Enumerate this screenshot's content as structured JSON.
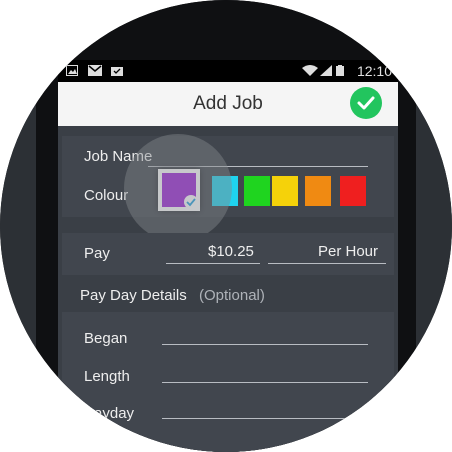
{
  "status_bar": {
    "time": "12:10",
    "icons": [
      "image-icon",
      "gmail-icon",
      "shopping-bag-icon",
      "wifi-icon",
      "signal-icon",
      "battery-icon"
    ]
  },
  "header": {
    "title": "Add Job",
    "confirm_icon": "check-circle-icon"
  },
  "form": {
    "job_name_label": "Job Name",
    "colour_label": "Colour",
    "colours": [
      "#9b1fd8",
      "#1fd3ef",
      "#1fd41f",
      "#f5d20a",
      "#f08a12",
      "#ef1f1f"
    ],
    "selected_colour": "#9b1fd8",
    "pay_label": "Pay",
    "pay_value": "$10.25",
    "pay_period": "Per Hour",
    "pay_day_header": "Pay Day Details",
    "pay_day_optional": "(Optional)",
    "began_label": "Began",
    "length_label": "Length",
    "payday_label": "Payday"
  },
  "colors": {
    "accent": "#22c55e",
    "header_bg": "#f5f5f5",
    "screen_bg": "#3a3f46"
  }
}
